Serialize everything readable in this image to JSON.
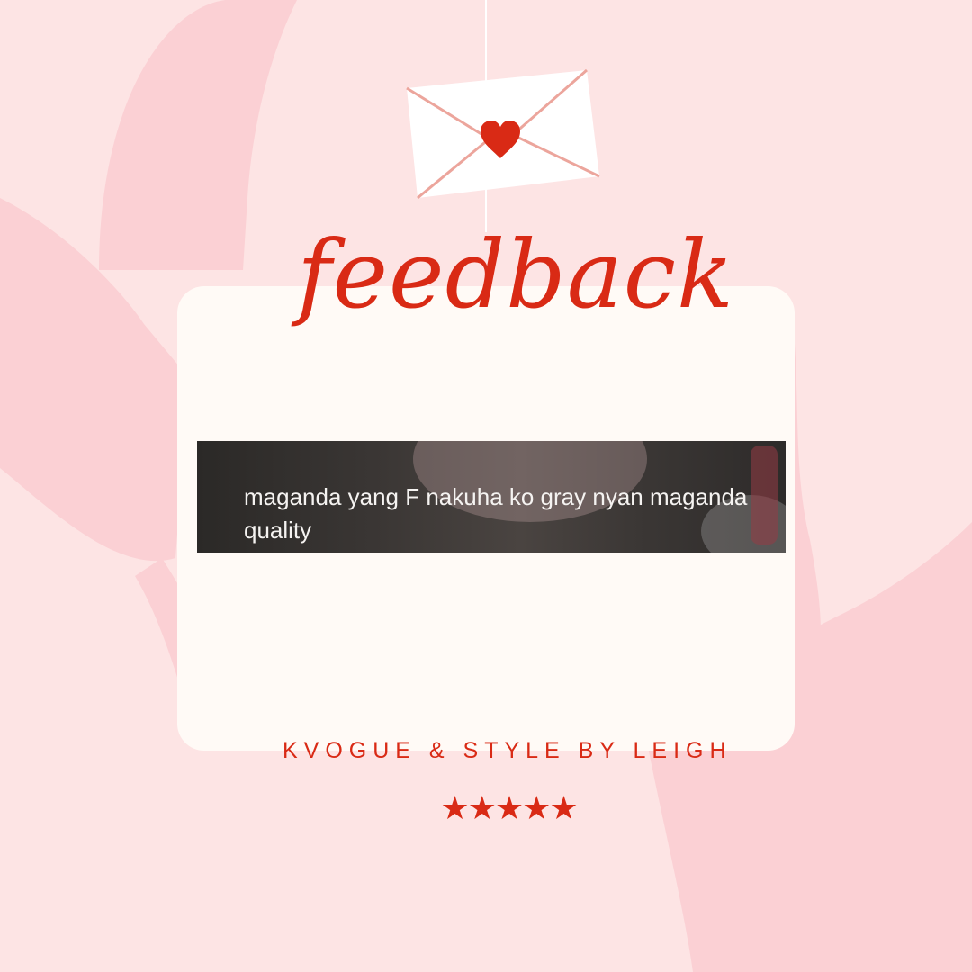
{
  "title": "feedback",
  "comment": "maganda yang F nakuha ko gray nyan maganda quality",
  "brand": "KVOGUE & STYLE BY LEIGH",
  "stars": "★★★★★",
  "rating": {
    "value": 5,
    "max": 5
  },
  "icons": {
    "envelope": "envelope-icon",
    "heart": "heart-icon"
  },
  "colors": {
    "background": "#fde4e4",
    "accent": "#d92a15",
    "card": "#fffaf6",
    "shape": "#fbd0d4"
  }
}
